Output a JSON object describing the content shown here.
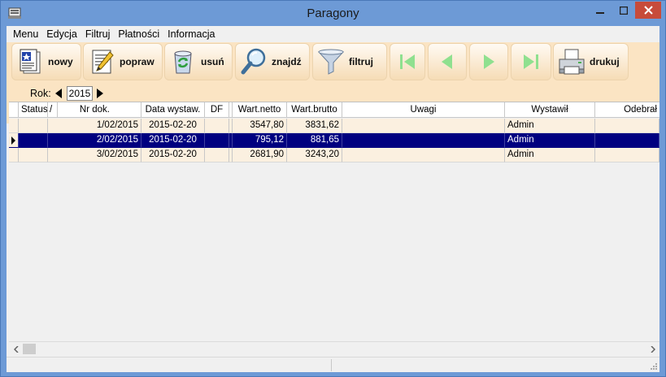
{
  "window": {
    "title": "Paragony"
  },
  "menu": [
    "Menu",
    "Edycja",
    "Filtruj",
    "Płatności",
    "Informacja"
  ],
  "toolbar": {
    "nowy": "nowy",
    "popraw": "popraw",
    "usun": "usuń",
    "znajdz": "znajdź",
    "filtruj": "filtruj",
    "drukuj": "drukuj"
  },
  "year": {
    "label": "Rok:",
    "value": "2015"
  },
  "grid": {
    "columns": [
      "Status",
      "/",
      "Nr dok.",
      "Data wystaw.",
      "DF",
      "Wart.netto",
      "Wart.brutto",
      "Uwagi",
      "Wystawił",
      "Odebrał"
    ],
    "rows": [
      {
        "nr": "1/02/2015",
        "data": "2015-02-20",
        "netto": "3547,80",
        "brutto": "3831,62",
        "wystawil": "Admin",
        "selected": false
      },
      {
        "nr": "2/02/2015",
        "data": "2015-02-20",
        "netto": "795,12",
        "brutto": "881,65",
        "wystawil": "Admin",
        "selected": true
      },
      {
        "nr": "3/02/2015",
        "data": "2015-02-20",
        "netto": "2681,90",
        "brutto": "3243,20",
        "wystawil": "Admin",
        "selected": false
      }
    ]
  },
  "colors": {
    "titlebar": "#6d9ad6",
    "toolbar_bg": "#fbe4c3",
    "selection": "#000080",
    "row_bg": "#fbf0e0",
    "close_btn": "#c74b3a"
  }
}
